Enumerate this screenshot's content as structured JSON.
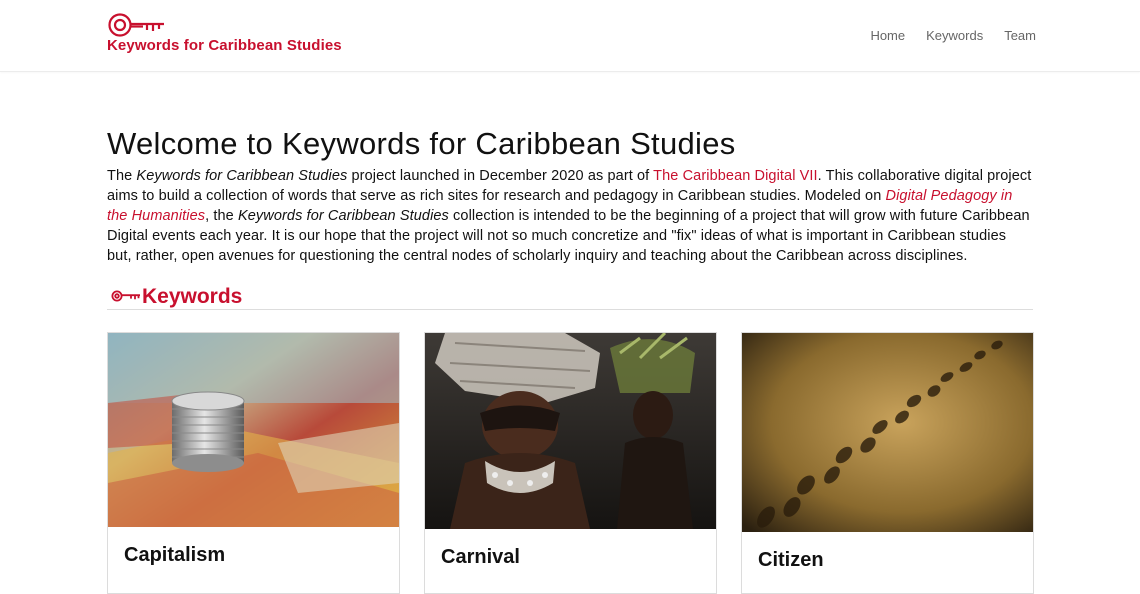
{
  "brand": {
    "name": "Keywords for Caribbean Studies",
    "accent": "#c8102e",
    "icon": "key-icon"
  },
  "nav": {
    "items": [
      "Home",
      "Keywords",
      "Team"
    ]
  },
  "welcome": {
    "title": "Welcome to Keywords for Caribbean Studies",
    "p": {
      "s1": "The ",
      "s2": "Keywords for Caribbean Studies",
      "s3": " project launched in December 2020 as part of ",
      "link1": "The Caribbean Digital VII",
      "s4": ". This collaborative digital project aims to build a collection of words that serve as rich sites for research and pedagogy in Caribbean studies. Modeled on ",
      "link2": "Digital Pedagogy in the Humanities",
      "s5": ", the ",
      "s6": "Keywords for Caribbean Studies",
      "s7": " collection is intended to be the beginning of a project that will grow with future Caribbean Digital events each year. It is our hope that the project will not so much concretize and \"fix\" ideas of what is important in Caribbean studies but, rather, open avenues for questioning the central nodes of scholarly inquiry and teaching about the Caribbean across disciplines."
    }
  },
  "keywords_section": {
    "title": "Keywords",
    "icon": "key-icon",
    "cards": [
      {
        "label": "Capitalism",
        "image": "coins-on-banknotes-photo"
      },
      {
        "label": "Carnival",
        "image": "carnival-masquerader-photo"
      },
      {
        "label": "Citizen",
        "image": "footprints-in-sand-photo"
      }
    ]
  }
}
